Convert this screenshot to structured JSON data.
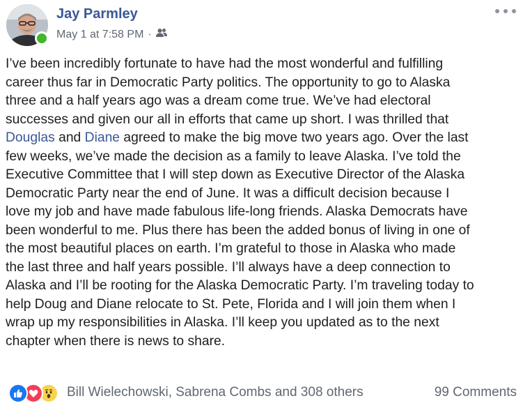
{
  "post": {
    "author": "Jay Parmley",
    "date": "May 1 at 7:58 PM",
    "separator": "·",
    "audience_icon": "friends-icon",
    "menu_icon": "more-options-icon",
    "lines": [
      [
        "I’ve been incredibly fortunate to have had the most wonderful and fulfilling"
      ],
      [
        "career thus far in Democratic Party politics. The opportunity to go to Alaska"
      ],
      [
        "three and a half years ago was a dream come true. We’ve had electoral"
      ],
      [
        "successes and given our all in efforts that came up short. I was thrilled that"
      ],
      [
        {
          "mention": "Douglas"
        },
        " and ",
        {
          "mention": "Diane"
        },
        " agreed to make the big move two years ago. Over the last"
      ],
      [
        "few weeks, we’ve made the decision as a family to leave Alaska. I’ve told the"
      ],
      [
        "Executive Committee that I will step down as Executive Director of the Alaska"
      ],
      [
        "Democratic Party near the end of June. It was a difficult decision because I"
      ],
      [
        "love my job and have made fabulous life-long friends. Alaska Democrats have"
      ],
      [
        "been wonderful to me. Plus there has been the added bonus of living in one of"
      ],
      [
        "the most beautiful places on earth. I’m grateful to those in Alaska who made"
      ],
      [
        "the last three and half years possible. I’ll always have a deep connection to"
      ],
      [
        "Alaska and I’ll be rooting for the Alaska Democratic Party. I’m traveling today to"
      ],
      [
        "help Doug and Diane relocate to St. Pete, Florida and I will join them when I"
      ],
      [
        "wrap up my responsibilities in Alaska. I’ll keep you updated as to the next"
      ],
      [
        "chapter when there is news to share."
      ]
    ]
  },
  "footer": {
    "reactions": [
      "like",
      "love",
      "wow"
    ],
    "summary": "Bill Wielechowski, Sabrena Combs and 308 others",
    "comments": "99 Comments"
  },
  "colors": {
    "link": "#385898",
    "meta": "#606770",
    "text": "#1c1e21",
    "online": "#42b72a"
  }
}
